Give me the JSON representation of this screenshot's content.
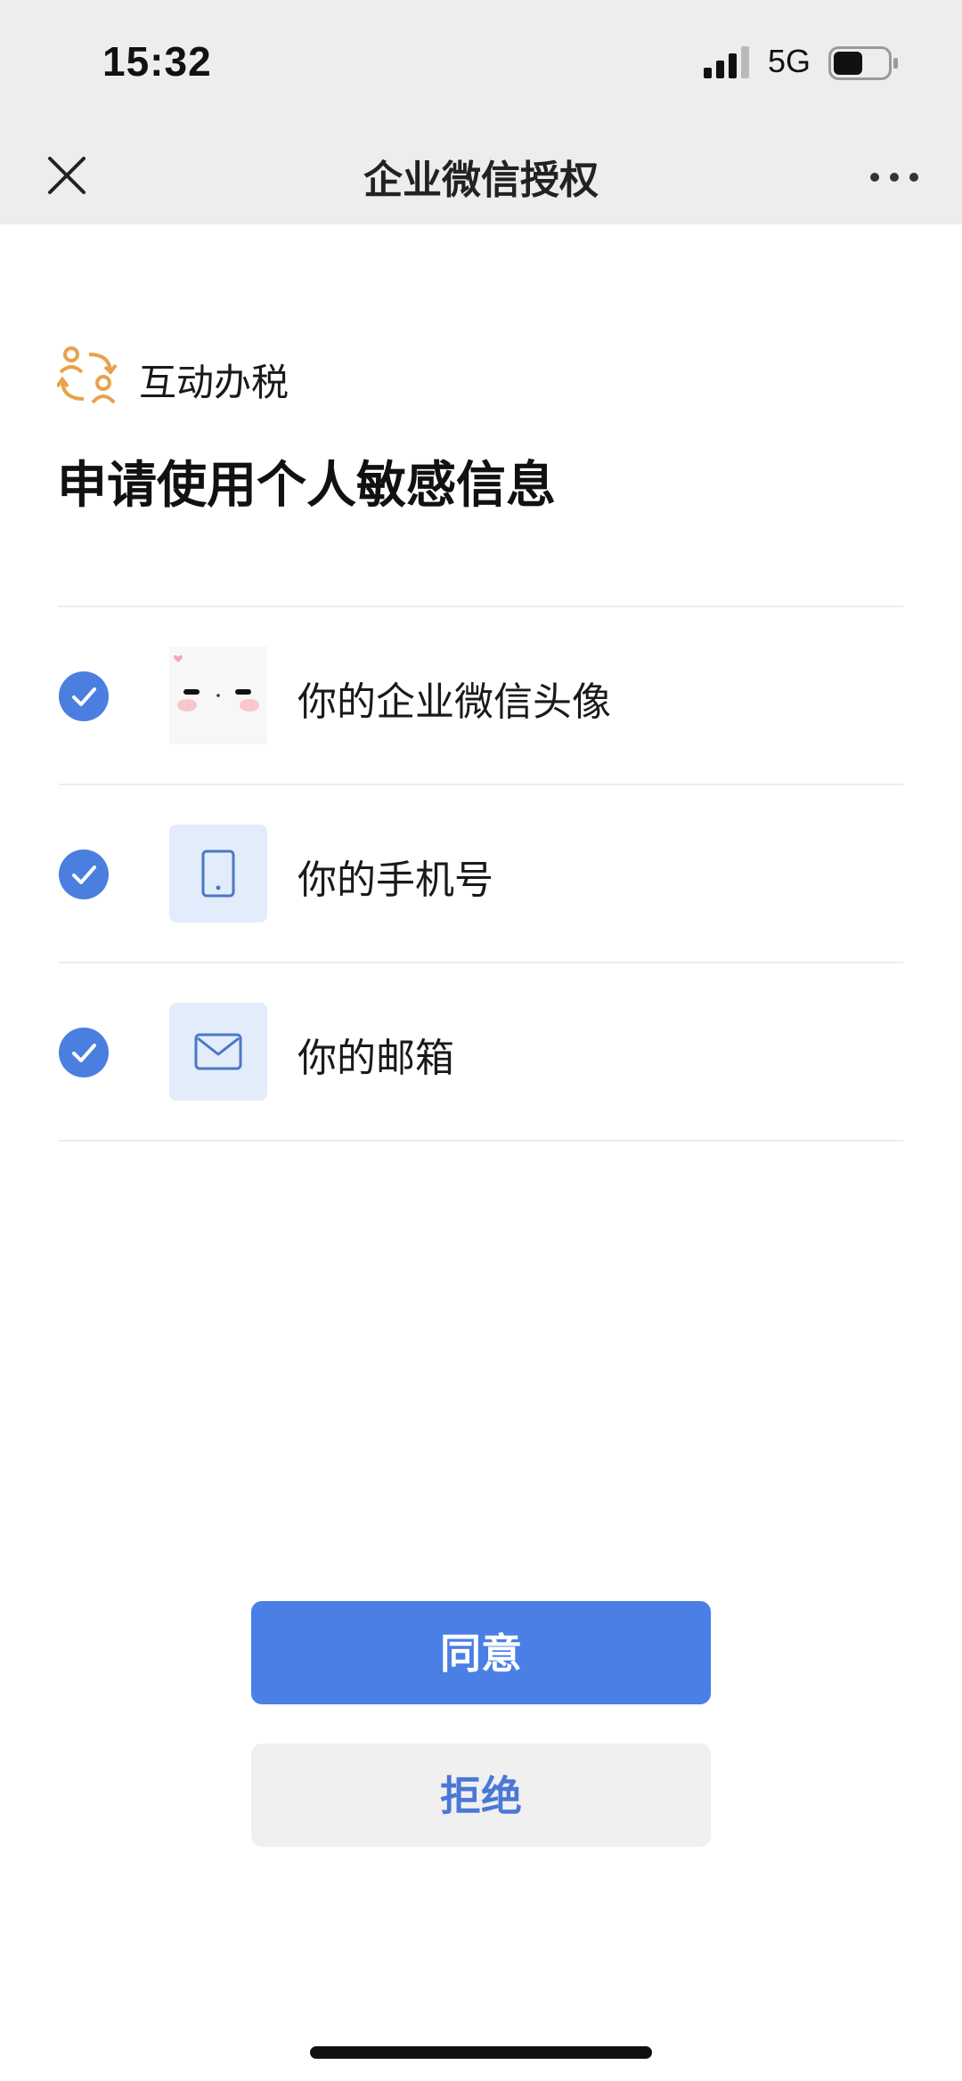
{
  "status_bar": {
    "time": "15:32",
    "network": "5G",
    "battery_level": 0.55
  },
  "nav": {
    "title": "企业微信授权",
    "close_icon": "close-icon",
    "more_icon": "more-icon"
  },
  "app": {
    "name": "互动办税",
    "logo_icon": "exchange-people-icon"
  },
  "heading": "申请使用个人敏感信息",
  "permissions": [
    {
      "label": "你的企业微信头像",
      "checked": true,
      "icon": "avatar-image"
    },
    {
      "label": "你的手机号",
      "checked": true,
      "icon": "phone-icon"
    },
    {
      "label": "你的邮箱",
      "checked": true,
      "icon": "mail-icon"
    }
  ],
  "buttons": {
    "agree": "同意",
    "reject": "拒绝"
  },
  "colors": {
    "accent": "#4a7fe6",
    "check": "#4a7fe0",
    "icon_tile": "#e3ecfa",
    "logo": "#e8a24a",
    "bar_bg": "#ededed"
  }
}
